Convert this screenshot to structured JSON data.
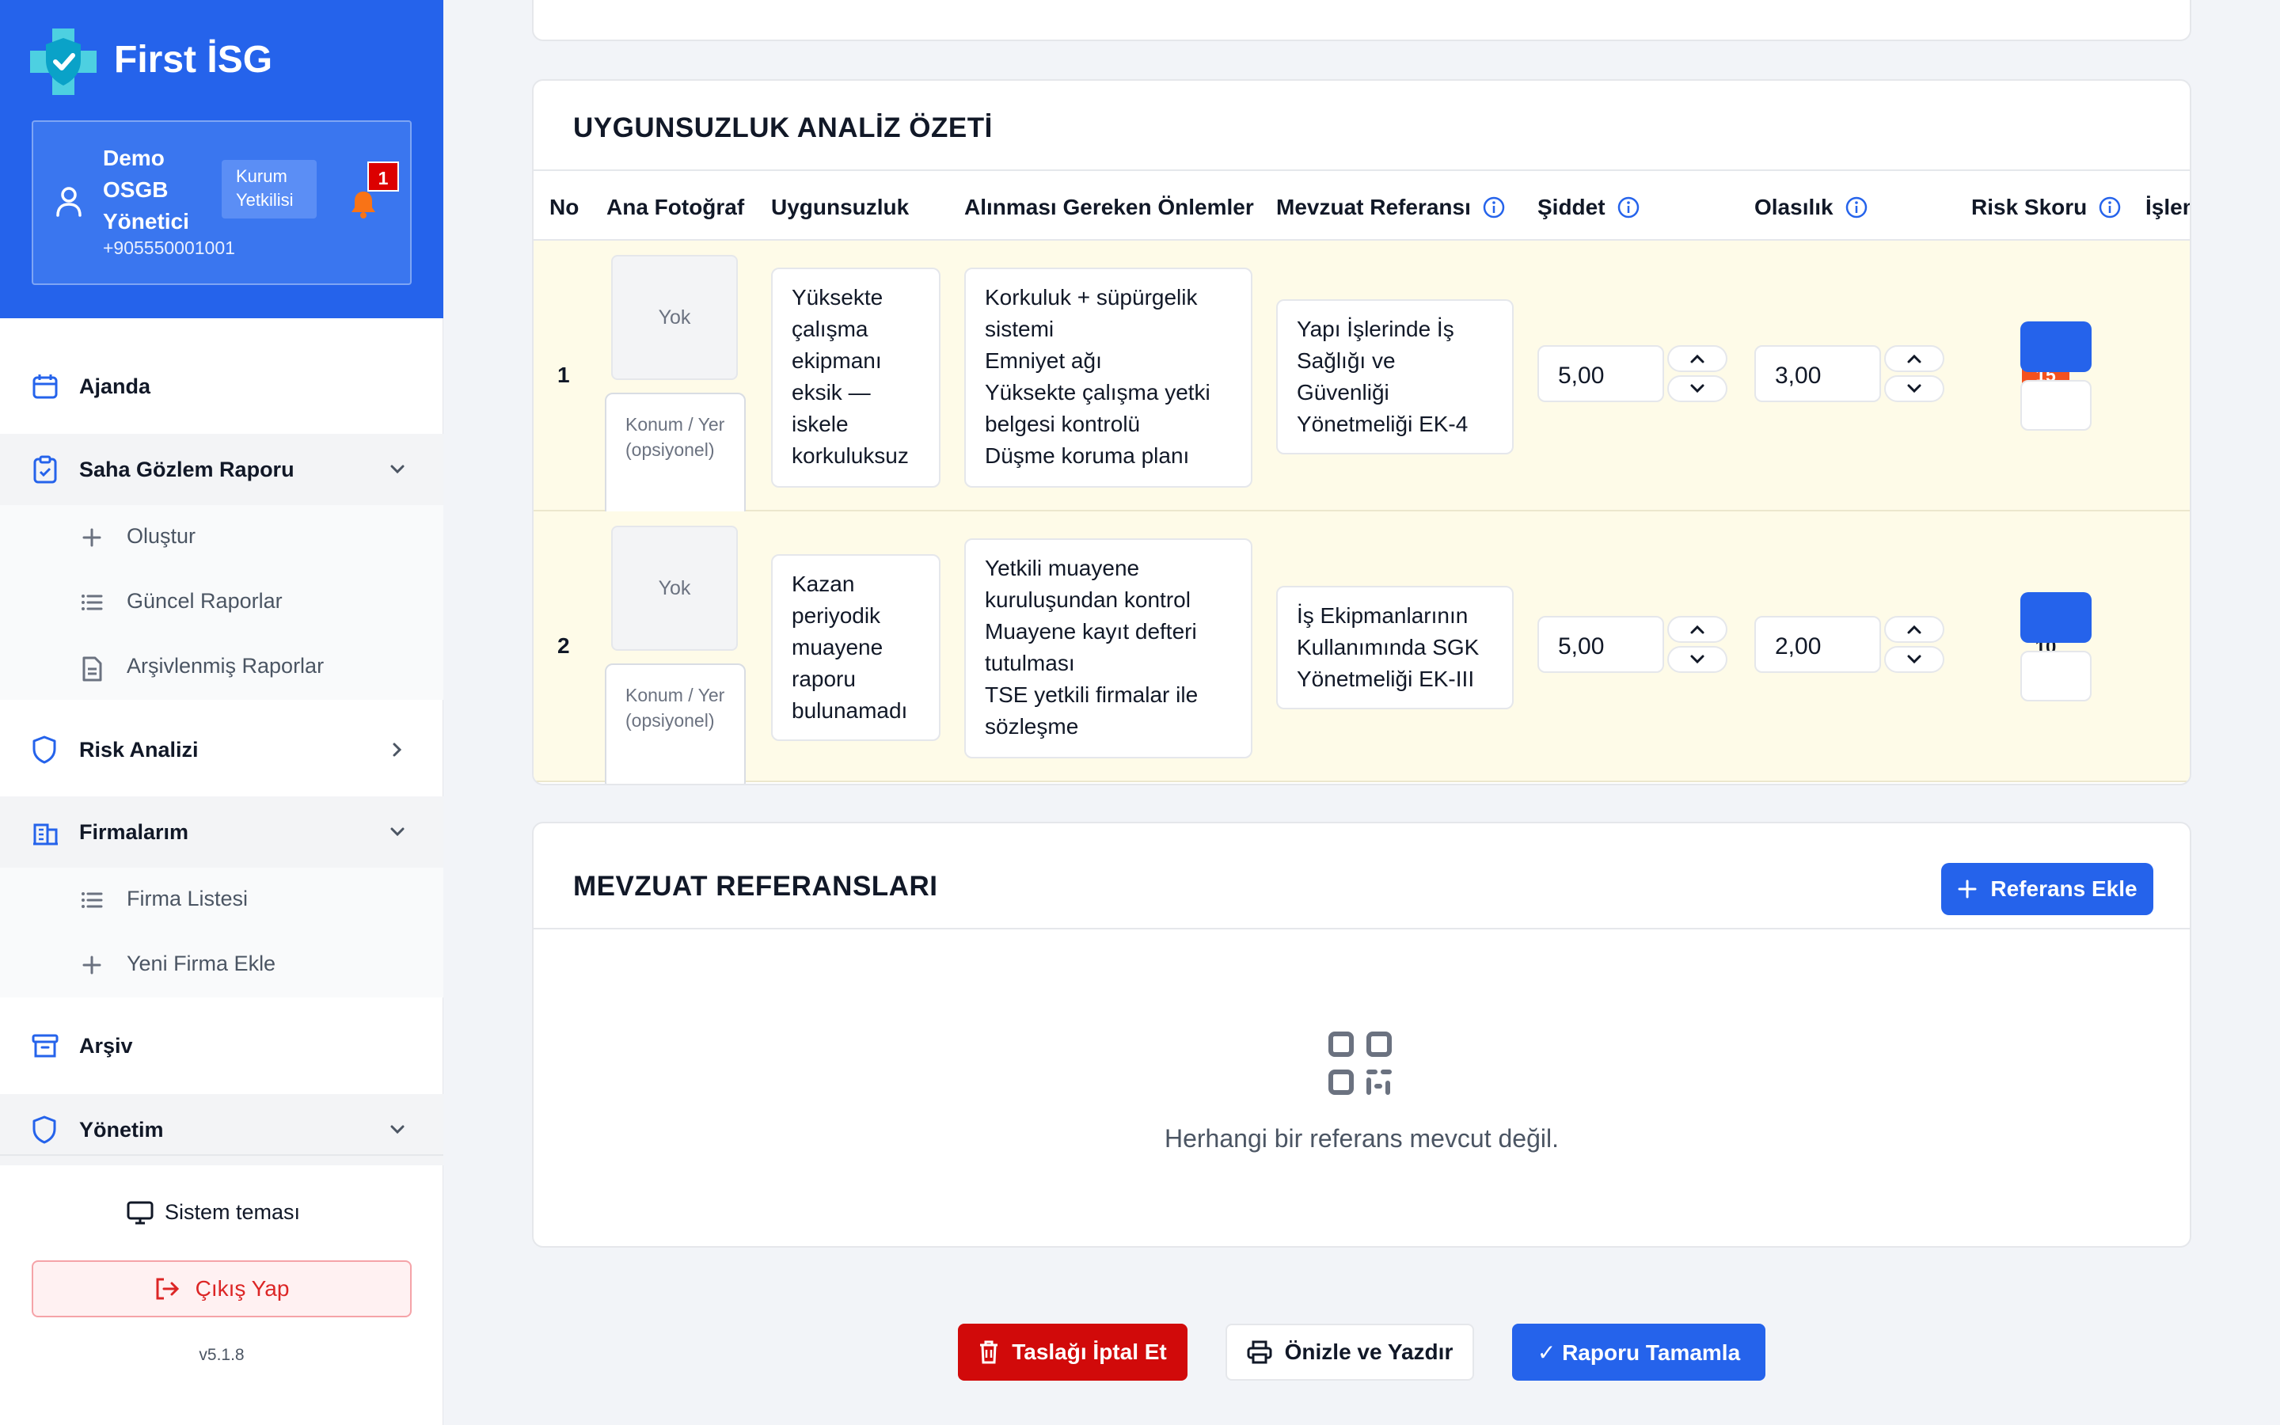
{
  "app": {
    "brand": "First İSG",
    "version": "v5.1.8"
  },
  "user": {
    "name": "Demo OSGB Yönetici",
    "phone": "+905550001001",
    "role": "Kurum Yetkilisi",
    "notifications": "1"
  },
  "nav": {
    "ajanda": "Ajanda",
    "saha": "Saha Gözlem Raporu",
    "saha_sub": [
      "Oluştur",
      "Güncel Raporlar",
      "Arşivlenmiş Raporlar"
    ],
    "risk": "Risk Analizi",
    "firmalar": "Firmalarım",
    "firmalar_sub": [
      "Firma Listesi",
      "Yeni Firma Ekle"
    ],
    "arsiv": "Arşiv",
    "yonetim": "Yönetim"
  },
  "footer": {
    "theme": "Sistem teması",
    "logout": "Çıkış Yap"
  },
  "analysis": {
    "title": "UYGUNSUZLUK ANALİZ ÖZETİ",
    "columns": {
      "no": "No",
      "photo": "Ana Fotoğraf",
      "issue": "Uygunsuzluk",
      "measures": "Alınması Gereken Önlemler",
      "reference": "Mevzuat Referansı",
      "severity": "Şiddet",
      "probability": "Olasılık",
      "risk": "Risk Skoru",
      "actions": "İşlem"
    },
    "photo_placeholder": "Yok",
    "location_placeholder": "Konum / Yer (opsiyonel)",
    "rows": [
      {
        "no": "1",
        "issue": "Yüksekte çalışma ekipmanı eksik — iskele korkuluksuz",
        "measures": [
          "Korkuluk + süpürgelik sistemi",
          "Emniyet ağı",
          "Yüksekte çalışma yetki belgesi kontrolü",
          "Düşme koruma planı"
        ],
        "reference": "Yapı İşlerinde İş Sağlığı ve Güvenliği Yönetmeliği EK-4",
        "severity": "5,00",
        "probability": "3,00",
        "risk": "15"
      },
      {
        "no": "2",
        "issue": "Kazan periyodik muayene raporu bulunamadı",
        "measures": [
          "Yetkili muayene kuruluşundan kontrol",
          "Muayene kayıt defteri tutulması",
          "TSE yetkili firmalar ile sözleşme"
        ],
        "reference": "İş Ekipmanlarının Kullanımında SGK Yönetmeliği EK-III",
        "severity": "5,00",
        "probability": "2,00",
        "risk": "10"
      }
    ]
  },
  "mevzuat": {
    "title": "MEVZUAT REFERANSLARI",
    "add_label": "Referans Ekle",
    "empty": "Herhangi bir referans mevcut değil."
  },
  "actions": {
    "cancel": "Taslağı İptal Et",
    "print": "Önizle ve Yazdır",
    "complete": "✓ Raporu Tamamla"
  },
  "colors": {
    "primary": "#2563eb",
    "danger": "#d10a0a",
    "risk_high": "#f4511e",
    "row_bg": "#fefbe8"
  }
}
